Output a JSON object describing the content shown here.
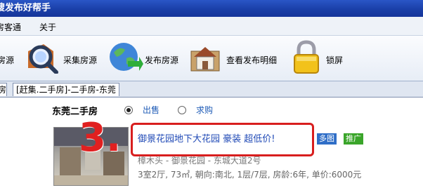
{
  "window": {
    "title": "搜发布好帮手"
  },
  "menu": {
    "items": [
      "房客通",
      "关于"
    ]
  },
  "toolbar": {
    "items": [
      {
        "label": "房源",
        "icon": "partial-tool-icon"
      },
      {
        "label": "采集房源",
        "icon": "magnifier-icon"
      },
      {
        "label": "发布房源",
        "icon": "globe-icon"
      },
      {
        "label": "查看发布明细",
        "icon": "house-folder-icon"
      },
      {
        "label": "锁屏",
        "icon": "padlock-icon"
      }
    ]
  },
  "tabs": [
    "房",
    "[赶集.二手房]-二手房-东莞"
  ],
  "content": {
    "heading": "东莞二手房",
    "radio_sale": "出售",
    "radio_buy": "求购",
    "annotation_number": "3.",
    "listing": {
      "title": "御景花园地下大花园 豪装 超低价!",
      "badge_photo": "多图",
      "badge_promo": "推广",
      "address": "樟木头 - 御景花园 - 东城大道2号",
      "details": "3室2厅, 73㎡, 朝向:南北, 1层/7层, 房龄:6年, 单价:6000元"
    }
  },
  "colors": {
    "titlebar": "#1a3fa8",
    "link": "#1f49b6",
    "annotation_red": "#d81e1e",
    "badge_photo": "#2f6ec7",
    "badge_promo": "#3aa52a"
  }
}
